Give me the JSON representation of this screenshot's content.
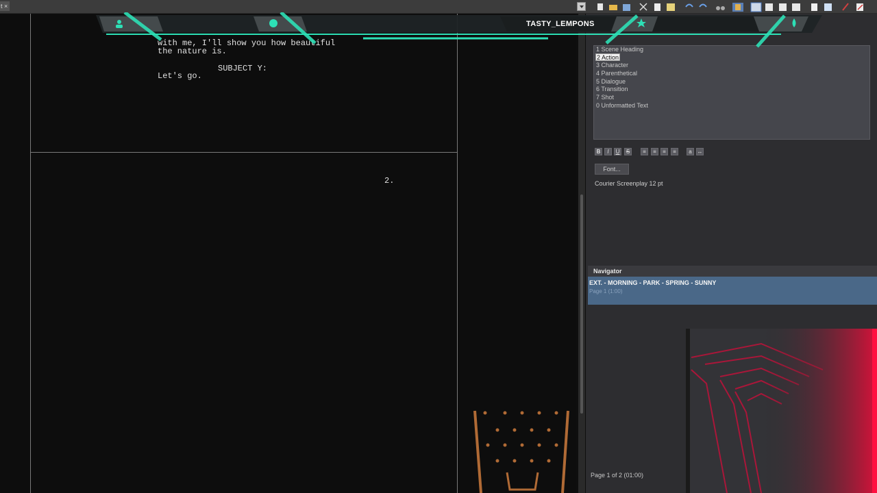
{
  "topbar": {
    "tab_fragment": "t ×"
  },
  "overlay": {
    "username": "TASTY_LEMPONS",
    "icons": [
      "person-icon",
      "dollar-icon",
      "star-icon",
      "droplet-icon"
    ],
    "accent": "#2de0b6"
  },
  "script": {
    "lines": [
      "with me, I'll show you how beautiful",
      "the nature is."
    ],
    "character": "SUBJECT Y:",
    "dialogue": "Let's go.",
    "page_number": "2."
  },
  "styles": {
    "items": [
      "1 Scene Heading",
      "2 Action",
      "3 Character",
      "4 Parenthetical",
      "5 Dialogue",
      "6 Transition",
      "7 Shot",
      "0 Unformatted Text"
    ],
    "selected_index": 1
  },
  "format_buttons": [
    "B",
    "I",
    "U",
    "S"
  ],
  "font_button": "Font...",
  "font_description": "Courier Screenplay 12 pt",
  "navigator": {
    "header": "Navigator",
    "scene": "EXT. - MORNING - PARK - SPRING - SUNNY",
    "scene_sub": "Page 1 (1:00)",
    "status": "Page 1 of 2 (01:00)"
  },
  "colors": {
    "accent_teal": "#2de0b6",
    "nav_selected": "#4a6888",
    "preview_red": "#e0103a",
    "cup_brown": "#b06a35"
  }
}
